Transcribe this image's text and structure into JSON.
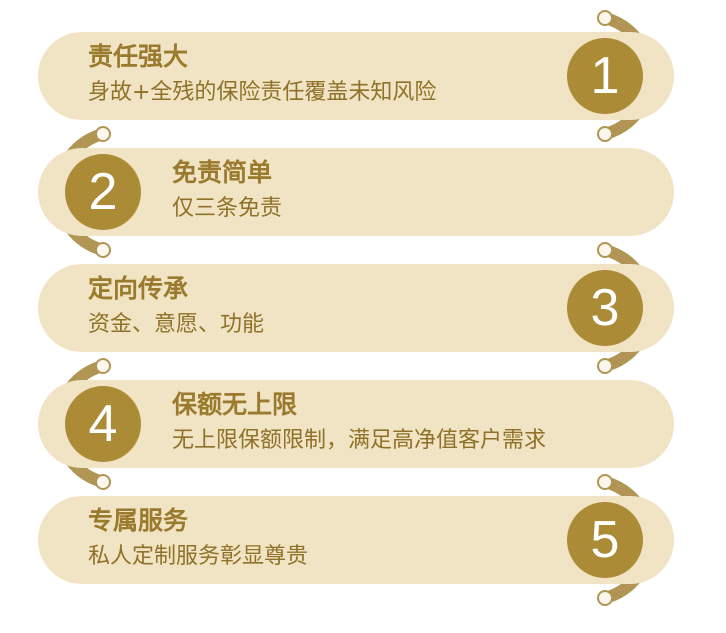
{
  "items": [
    {
      "number": "1",
      "title": "责任强大",
      "desc": "身故+全残的保险责任覆盖未知风险"
    },
    {
      "number": "2",
      "title": "免责简单",
      "desc": "仅三条免责"
    },
    {
      "number": "3",
      "title": "定向传承",
      "desc": "资金、意愿、功能"
    },
    {
      "number": "4",
      "title": "保额无上限",
      "desc": "无上限保额限制，满足高净值客户需求"
    },
    {
      "number": "5",
      "title": "专属服务",
      "desc": "私人定制服务彰显尊贵"
    }
  ],
  "colors": {
    "pill": "#f0e4c5",
    "arc": "#b09554",
    "badge": "#ac8b37",
    "text": "#9a7a2c"
  }
}
